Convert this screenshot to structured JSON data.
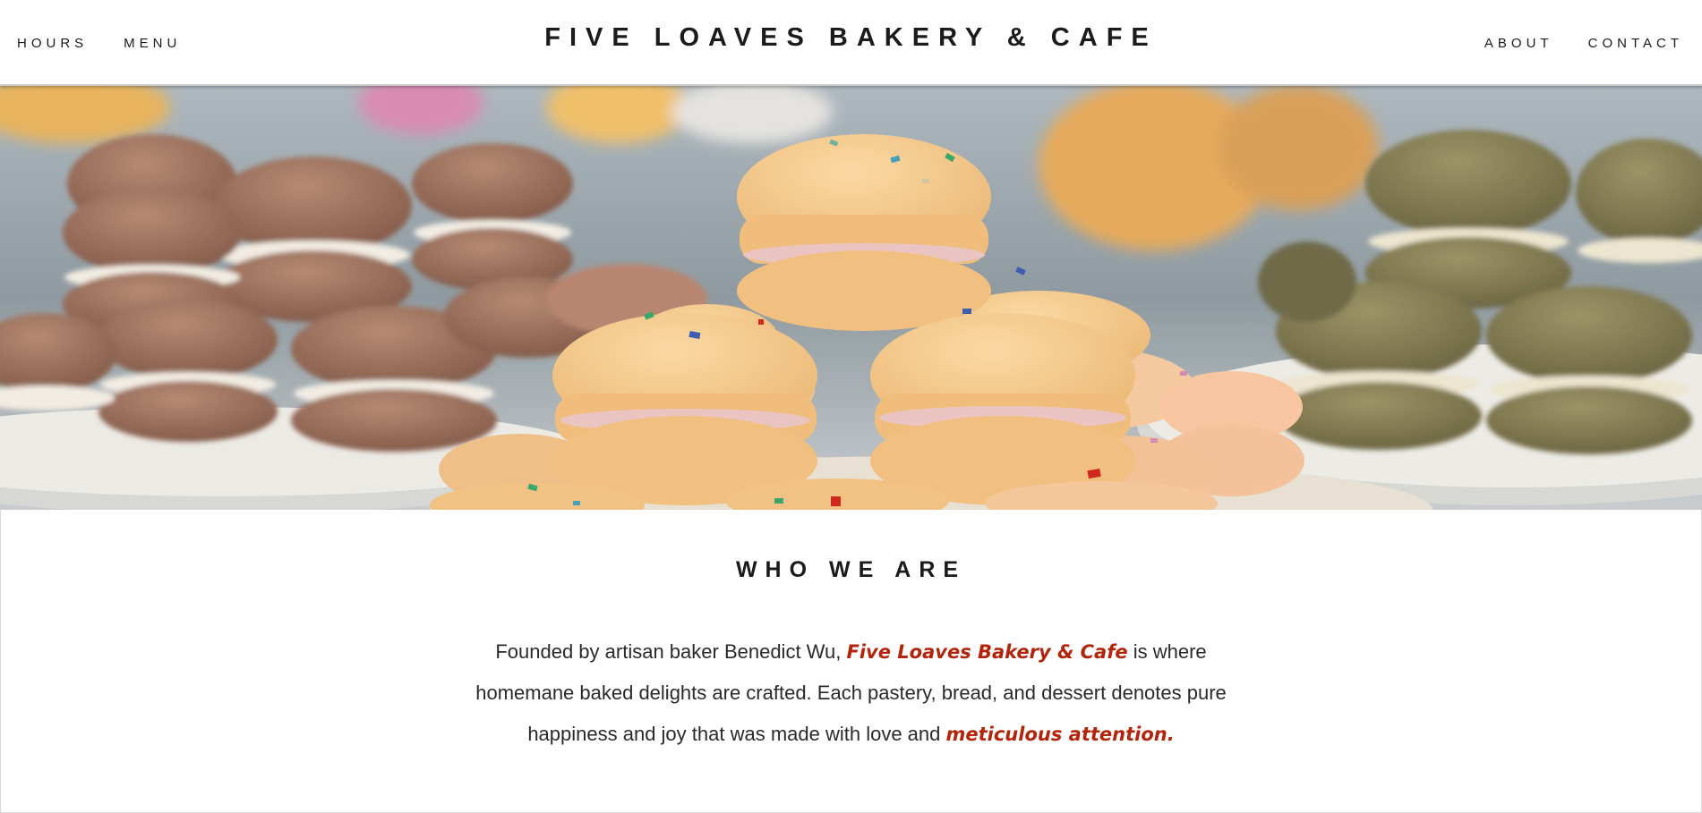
{
  "header": {
    "brand": "FIVE LOAVES BAKERY & CAFE",
    "nav_left": [
      {
        "label": "HOURS"
      },
      {
        "label": "MENU"
      }
    ],
    "nav_right": [
      {
        "label": "ABOUT"
      },
      {
        "label": "CONTACT"
      }
    ]
  },
  "hero": {
    "image_subject": "macarons-photo"
  },
  "about": {
    "title": "WHO WE ARE",
    "text_1": "Founded by artisan baker Benedict Wu, ",
    "highlight_1": "Five Loaves Bakery & Cafe",
    "text_2": " is where homemane baked delights are crafted. Each pastery, bread, and dessert denotes pure happiness and joy that was made with love and ",
    "highlight_2": "meticulous attention."
  },
  "colors": {
    "accent": "#b3250b",
    "text": "#1b1b1b",
    "background": "#ffffff"
  }
}
